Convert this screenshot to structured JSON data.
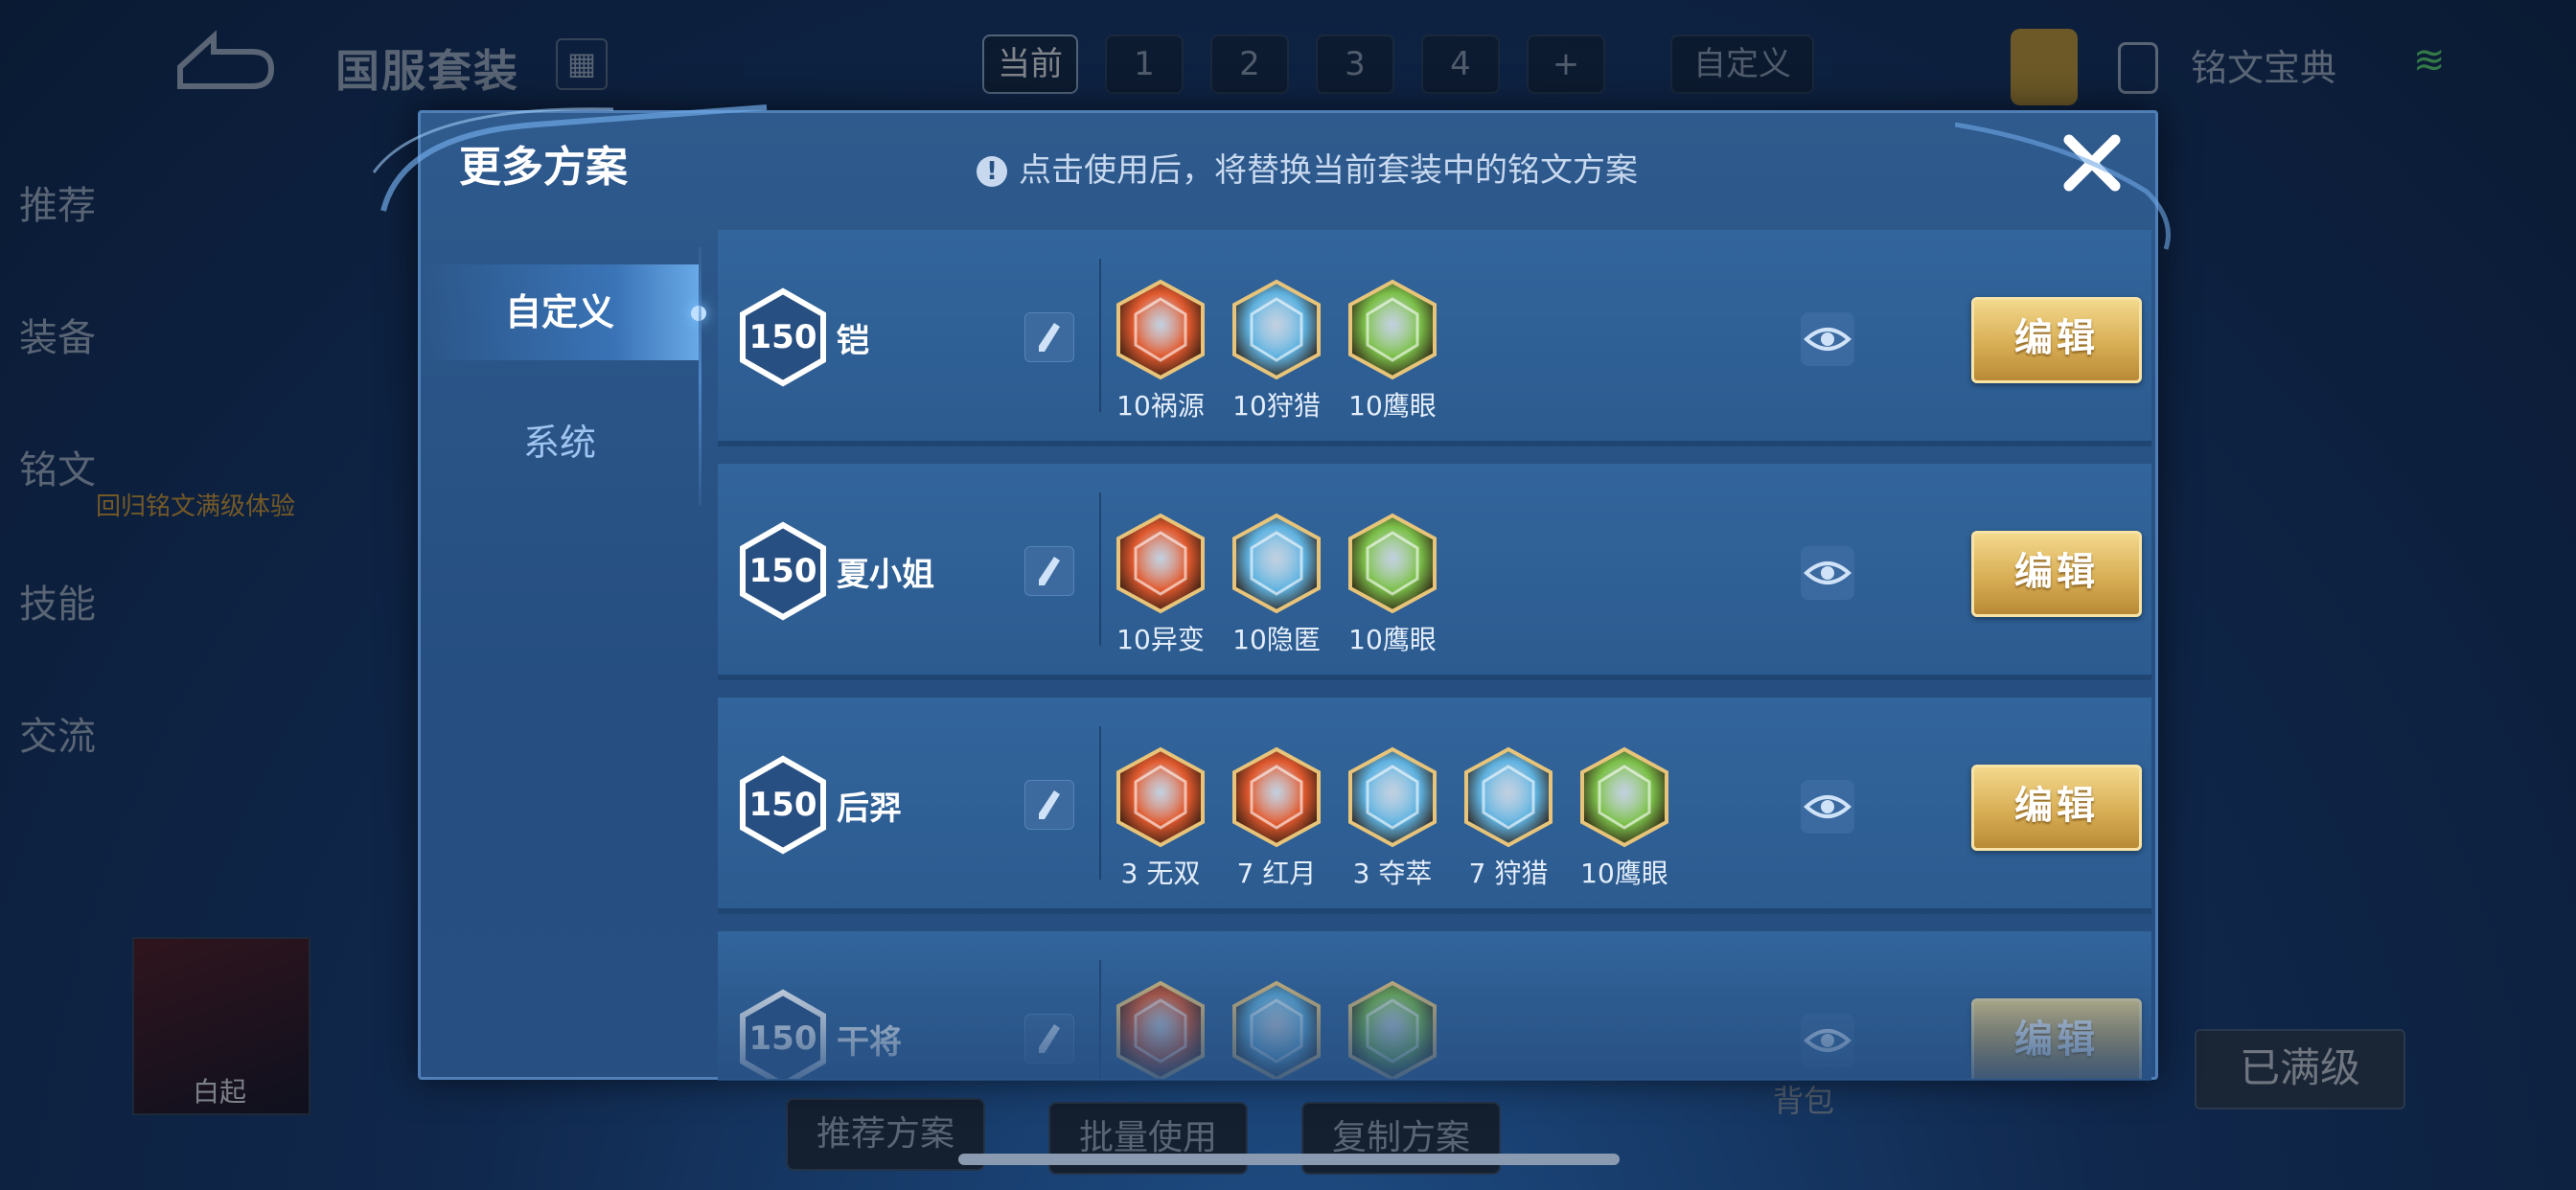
{
  "background": {
    "title": "国服套装",
    "preset_tabs": [
      "当前",
      "1",
      "2",
      "3",
      "4",
      "+"
    ],
    "custom_tab": "自定义",
    "codex_label": "铭文宝典",
    "nav": [
      "推荐",
      "装备",
      "铭文",
      "技能",
      "交流"
    ],
    "nav_sub": "回归铭文满级体验",
    "hero_name": "白起",
    "bottom_buttons": [
      "推荐方案",
      "批量使用",
      "复制方案"
    ],
    "bag_label": "背包",
    "maxed_label": "已满级"
  },
  "modal": {
    "title": "更多方案",
    "hint": "点击使用后，将替换当前套装中的铭文方案",
    "tabs": [
      "自定义",
      "系统"
    ],
    "edit_label": "编辑",
    "rows": [
      {
        "level": "150",
        "hero": "铠",
        "runes": [
          {
            "count": "10",
            "name": "祸源",
            "color": "#e0592e"
          },
          {
            "count": "10",
            "name": "狩猎",
            "color": "#5fb2e0"
          },
          {
            "count": "10",
            "name": "鹰眼",
            "color": "#7cc04a"
          }
        ]
      },
      {
        "level": "150",
        "hero": "夏小姐",
        "runes": [
          {
            "count": "10",
            "name": "异变",
            "color": "#e0592e"
          },
          {
            "count": "10",
            "name": "隐匿",
            "color": "#5fb2e0"
          },
          {
            "count": "10",
            "name": "鹰眼",
            "color": "#7cc04a"
          }
        ]
      },
      {
        "level": "150",
        "hero": "后羿",
        "runes": [
          {
            "count": "3 ",
            "name": "无双",
            "color": "#e0592e"
          },
          {
            "count": "7 ",
            "name": "红月",
            "color": "#e0592e"
          },
          {
            "count": "3 ",
            "name": "夺萃",
            "color": "#5fb2e0"
          },
          {
            "count": "7 ",
            "name": "狩猎",
            "color": "#5fb2e0"
          },
          {
            "count": "10",
            "name": "鹰眼",
            "color": "#7cc04a"
          }
        ]
      },
      {
        "level": "150",
        "hero": "干将",
        "runes": [
          {
            "count": "",
            "name": "",
            "color": "#e0592e"
          },
          {
            "count": "",
            "name": "",
            "color": "#5fb2e0"
          },
          {
            "count": "",
            "name": "",
            "color": "#7cc04a"
          }
        ]
      }
    ]
  }
}
